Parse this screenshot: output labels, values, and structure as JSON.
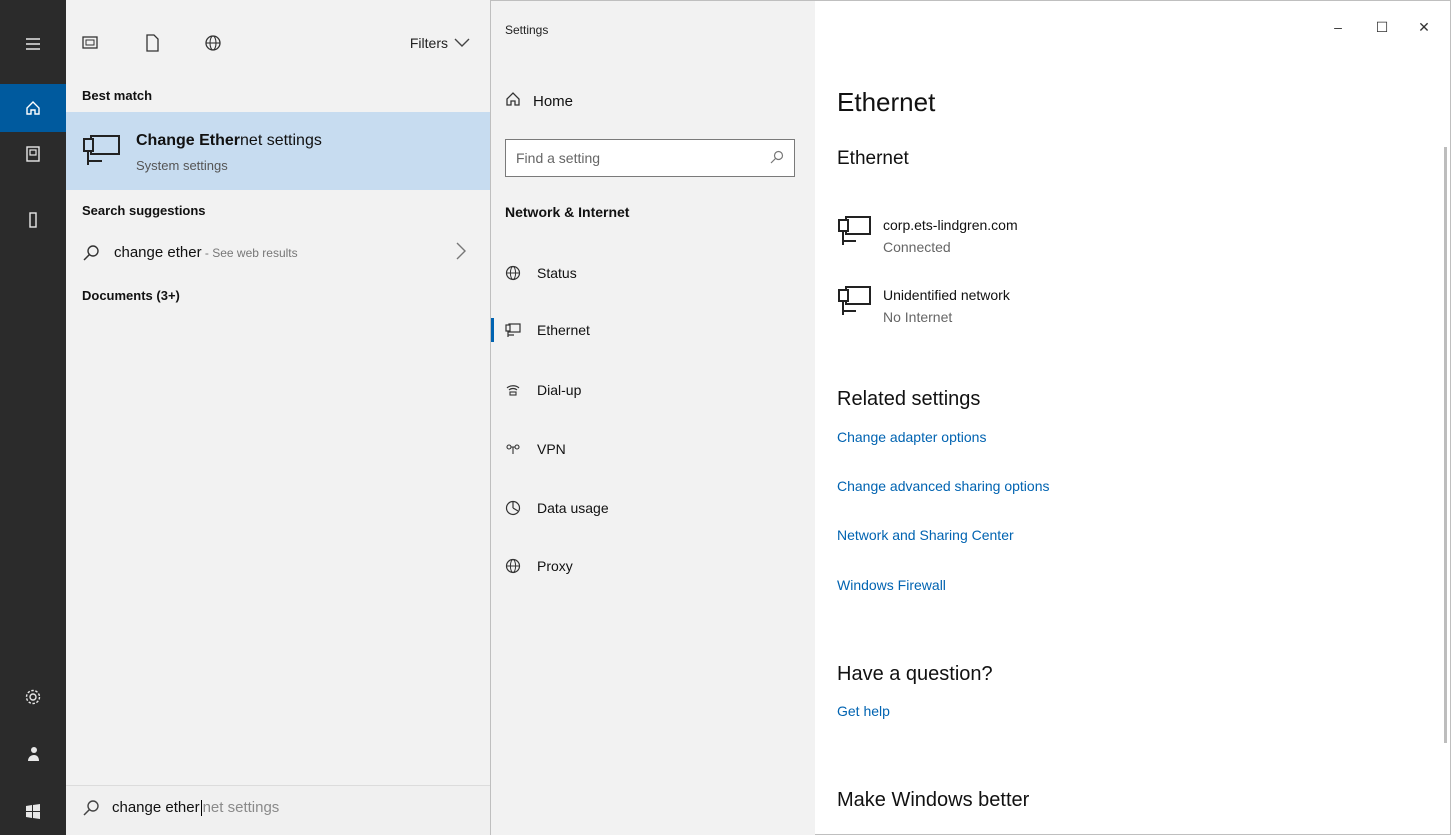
{
  "rail": {
    "icons": [
      "hamburger-icon",
      "home-icon",
      "notebook-icon",
      "device-icon",
      "gear-icon",
      "user-icon",
      "windows-icon"
    ]
  },
  "search": {
    "filters_label": "Filters",
    "best_match_header": "Best match",
    "best_match": {
      "title_bold": "Change Ether",
      "title_rest": "net settings",
      "subtitle": "System settings"
    },
    "suggestions_header": "Search suggestions",
    "suggestion": {
      "query": "change ether",
      "web_hint": " - See web results"
    },
    "documents_header": "Documents (3+)",
    "box": {
      "typed": "change ether",
      "autocomplete": "net settings"
    }
  },
  "settings": {
    "window_title": "Settings",
    "controls": {
      "minimize": "–",
      "maximize": "☐",
      "close": "✕"
    },
    "nav": {
      "home_label": "Home",
      "search_placeholder": "Find a setting",
      "group_label": "Network & Internet",
      "items": [
        {
          "label": "Status",
          "icon": "globe-status-icon"
        },
        {
          "label": "Ethernet",
          "icon": "ethernet-icon",
          "selected": true
        },
        {
          "label": "Dial-up",
          "icon": "dialup-icon"
        },
        {
          "label": "VPN",
          "icon": "vpn-icon"
        },
        {
          "label": "Data usage",
          "icon": "data-usage-icon"
        },
        {
          "label": "Proxy",
          "icon": "proxy-icon"
        }
      ]
    },
    "page": {
      "title": "Ethernet",
      "section_ethernet": "Ethernet",
      "networks": [
        {
          "name": "corp.ets-lindgren.com",
          "status": "Connected"
        },
        {
          "name": "Unidentified network",
          "status": "No Internet"
        }
      ],
      "related_title": "Related settings",
      "related_links": [
        "Change adapter options",
        "Change advanced sharing options",
        "Network and Sharing Center",
        "Windows Firewall"
      ],
      "question_title": "Have a question?",
      "get_help": "Get help",
      "better_title": "Make Windows better"
    },
    "colors": {
      "accent": "#0063b1",
      "rail": "#2b2b2b",
      "highlight": "#c7dcf0"
    }
  }
}
